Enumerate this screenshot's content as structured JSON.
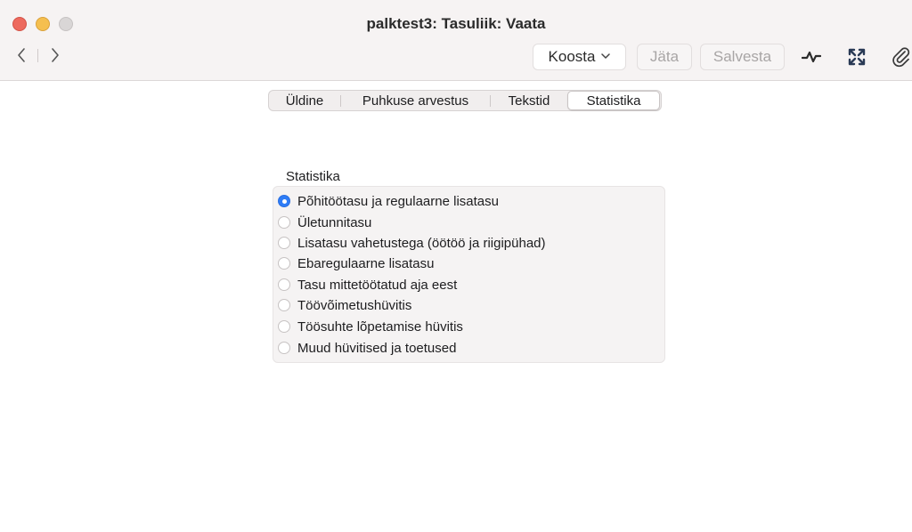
{
  "window": {
    "title": "palktest3: Tasuliik: Vaata"
  },
  "toolbar": {
    "koosta_label": "Koosta",
    "jata_label": "Jäta",
    "salvesta_label": "Salvesta"
  },
  "tabs": [
    {
      "label": "Üldine",
      "active": false
    },
    {
      "label": "Puhkuse arvestus",
      "active": false
    },
    {
      "label": "Tekstid",
      "active": false
    },
    {
      "label": "Statistika",
      "active": true
    }
  ],
  "statistika": {
    "group_label": "Statistika",
    "options": [
      {
        "label": "Põhitöötasu ja regulaarne lisatasu",
        "checked": true
      },
      {
        "label": "Ületunnitasu",
        "checked": false
      },
      {
        "label": "Lisatasu vahetustega (öötöö ja riigipühad)",
        "checked": false
      },
      {
        "label": "Ebaregulaarne lisatasu",
        "checked": false
      },
      {
        "label": "Tasu mittetöötatud aja eest",
        "checked": false
      },
      {
        "label": "Töövõimetushüvitis",
        "checked": false
      },
      {
        "label": "Töösuhte lõpetamise hüvitis",
        "checked": false
      },
      {
        "label": "Muud hüvitised ja toetused",
        "checked": false
      }
    ]
  },
  "colors": {
    "accent": "#2e7cf6",
    "close": "#ed6a5e",
    "minimize": "#f5bf4f",
    "zoom_inactive": "#d9d6d6"
  },
  "icons": {
    "back": "chevron-left-icon",
    "forward": "chevron-right-icon",
    "activity": "activity-icon",
    "expand": "expand-arrows-icon",
    "attachment": "paperclip-icon"
  }
}
